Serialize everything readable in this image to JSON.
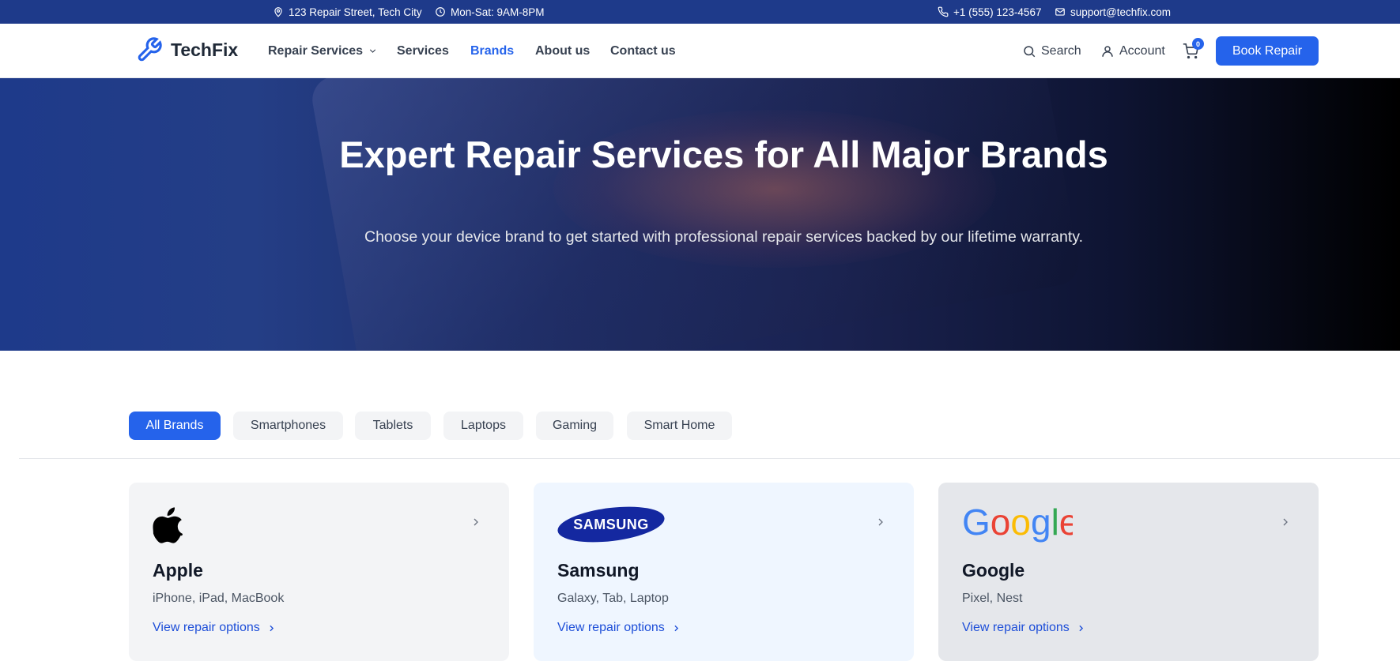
{
  "topbar": {
    "address": "123 Repair Street, Tech City",
    "hours": "Mon-Sat: 9AM-8PM",
    "phone": "+1 (555) 123-4567",
    "email": "support@techfix.com"
  },
  "nav": {
    "brand": "TechFix",
    "links": [
      "Repair Services",
      "Services",
      "Brands",
      "About us",
      "Contact us"
    ],
    "active": "Brands",
    "search_label": "Search",
    "account_label": "Account",
    "cart_count": "0",
    "book_button": "Book Repair"
  },
  "hero": {
    "title": "Expert Repair Services for All Major Brands",
    "subtitle": "Choose your device brand to get started with professional repair services backed by our lifetime warranty."
  },
  "filters": {
    "tabs": [
      "All Brands",
      "Smartphones",
      "Tablets",
      "Laptops",
      "Gaming",
      "Smart Home"
    ],
    "active": "All Brands"
  },
  "brands": [
    {
      "name": "Apple",
      "devices": "iPhone, iPad, MacBook",
      "link": "View repair options",
      "logo": "apple-logo"
    },
    {
      "name": "Samsung",
      "devices": "Galaxy, Tab, Laptop",
      "link": "View repair options",
      "logo": "samsung-logo",
      "logo_text": "SAMSUNG"
    },
    {
      "name": "Google",
      "devices": "Pixel, Nest",
      "link": "View repair options",
      "logo": "google-logo",
      "logo_text": "Google"
    }
  ],
  "colors": {
    "primary": "#2563eb",
    "topbar": "#1e3a8a",
    "card_apple": "#f3f4f6",
    "card_samsung": "#eff6ff",
    "card_google": "#e5e7eb"
  }
}
